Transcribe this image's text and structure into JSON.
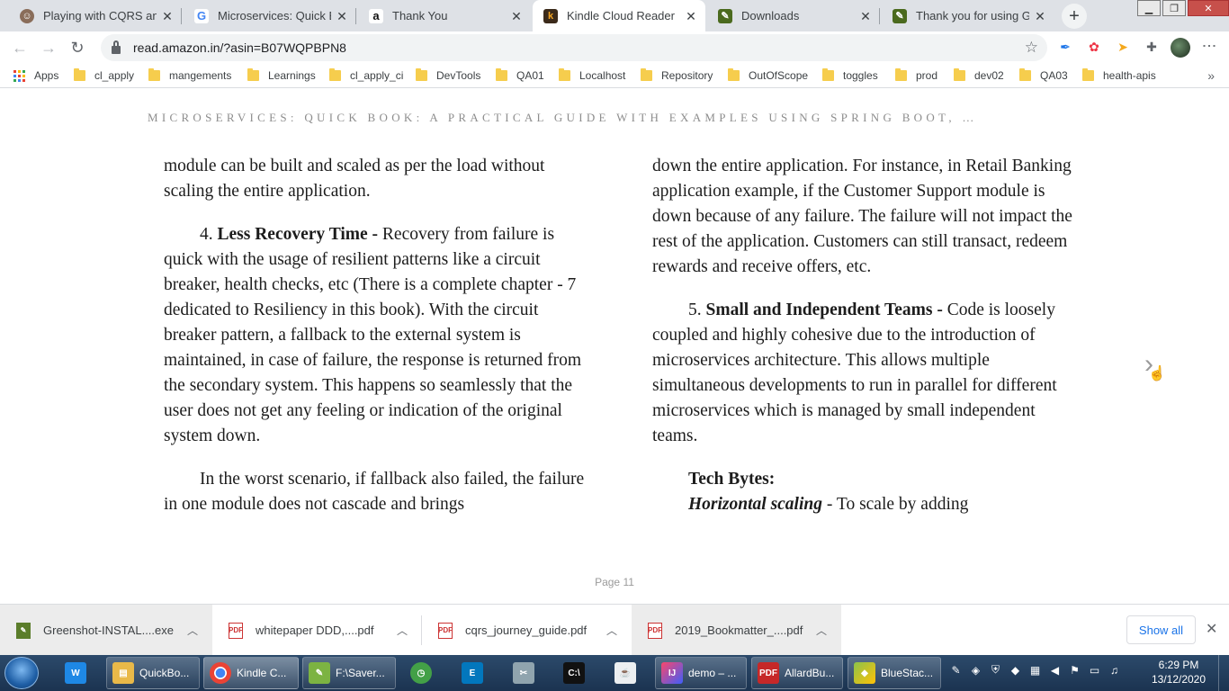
{
  "browser": {
    "tabs": [
      {
        "title": "Playing with CQRS and E",
        "icon": "avatar-icon"
      },
      {
        "title": "Microservices: Quick Boo",
        "icon": "google-icon"
      },
      {
        "title": "Thank You",
        "icon": "amazon-icon"
      },
      {
        "title": "Kindle Cloud Reader",
        "icon": "kindle-icon",
        "active": true
      },
      {
        "title": "Downloads",
        "icon": "greenshot-icon"
      },
      {
        "title": "Thank you for using Gree",
        "icon": "greenshot-icon"
      }
    ],
    "url": "read.amazon.in/?asin=B07WQPBPN8"
  },
  "bookmarks": [
    "Apps",
    "cl_apply",
    "mangements",
    "Learnings",
    "cl_apply_ci",
    "DevTools",
    "QA01",
    "Localhost",
    "Repository",
    "OutOfScope",
    "toggles",
    "prod",
    "dev02",
    "QA03",
    "health-apis"
  ],
  "reader": {
    "book_title": "MICROSERVICES: QUICK BOOK: A PRACTICAL GUIDE WITH EXAMPLES USING SPRING BOOT, …",
    "left": {
      "p1": "module can be built and scaled as per the load without scaling the entire application.",
      "p2_num": "4. ",
      "p2_bold": "Less Recovery Time - ",
      "p2_text": "Recovery from failure is quick with the usage of resilient patterns like a circuit breaker, health checks, etc (There is a complete chapter - 7 dedicated to Resiliency in this book). With the circuit breaker pattern, a fallback to the external system is maintained, in case of failure, the response is returned from the secondary system. This happens so seamlessly that the user does not get any feeling or indication of the original system down.",
      "p3": "In the worst scenario, if fallback also failed, the failure in one module does not cascade and brings"
    },
    "right": {
      "p1": "down the entire application. For instance, in Retail Banking application example, if the Customer Support module is down because of any failure. The failure will not impact the rest of the application. Customers can still transact, redeem rewards and receive offers, etc.",
      "p2_num": "5. ",
      "p2_bold": "Small and Independent Teams - ",
      "p2_text": "Code is loosely coupled and highly cohesive due to the introduction of microservices architecture. This allows multiple simultaneous developments to run in parallel for different microservices which is managed by small independent teams.",
      "tech_bytes": "Tech Bytes:",
      "h_scaling": "Horizontal scaling",
      "h_scaling_text": " - To scale by adding"
    },
    "page_label": "Page 11"
  },
  "downloads": [
    {
      "name": "Greenshot-INSTAL....exe",
      "type": "exe"
    },
    {
      "name": "whitepaper DDD,....pdf",
      "type": "pdf"
    },
    {
      "name": "cqrs_journey_guide.pdf",
      "type": "pdf"
    },
    {
      "name": "2019_Bookmatter_....pdf",
      "type": "pdf"
    }
  ],
  "show_all": "Show all",
  "taskbar": {
    "items": [
      {
        "label": "",
        "icon": "app-icon"
      },
      {
        "label": "QuickBo...",
        "icon": "folder-icon"
      },
      {
        "label": "Kindle C...",
        "icon": "chrome-icon"
      },
      {
        "label": "F:\\Saver...",
        "icon": "notepad-icon"
      },
      {
        "label": "",
        "icon": "clock-app-icon"
      },
      {
        "label": "",
        "icon": "editor-icon"
      },
      {
        "label": "",
        "icon": "snipping-icon"
      },
      {
        "label": "",
        "icon": "terminal-icon"
      },
      {
        "label": "",
        "icon": "java-icon"
      },
      {
        "label": "demo – ...",
        "icon": "intellij-icon"
      },
      {
        "label": "AllardBu...",
        "icon": "pdf-icon"
      },
      {
        "label": "BlueStac...",
        "icon": "bluestacks-icon"
      }
    ],
    "time": "6:29 PM",
    "date": "13/12/2020"
  }
}
